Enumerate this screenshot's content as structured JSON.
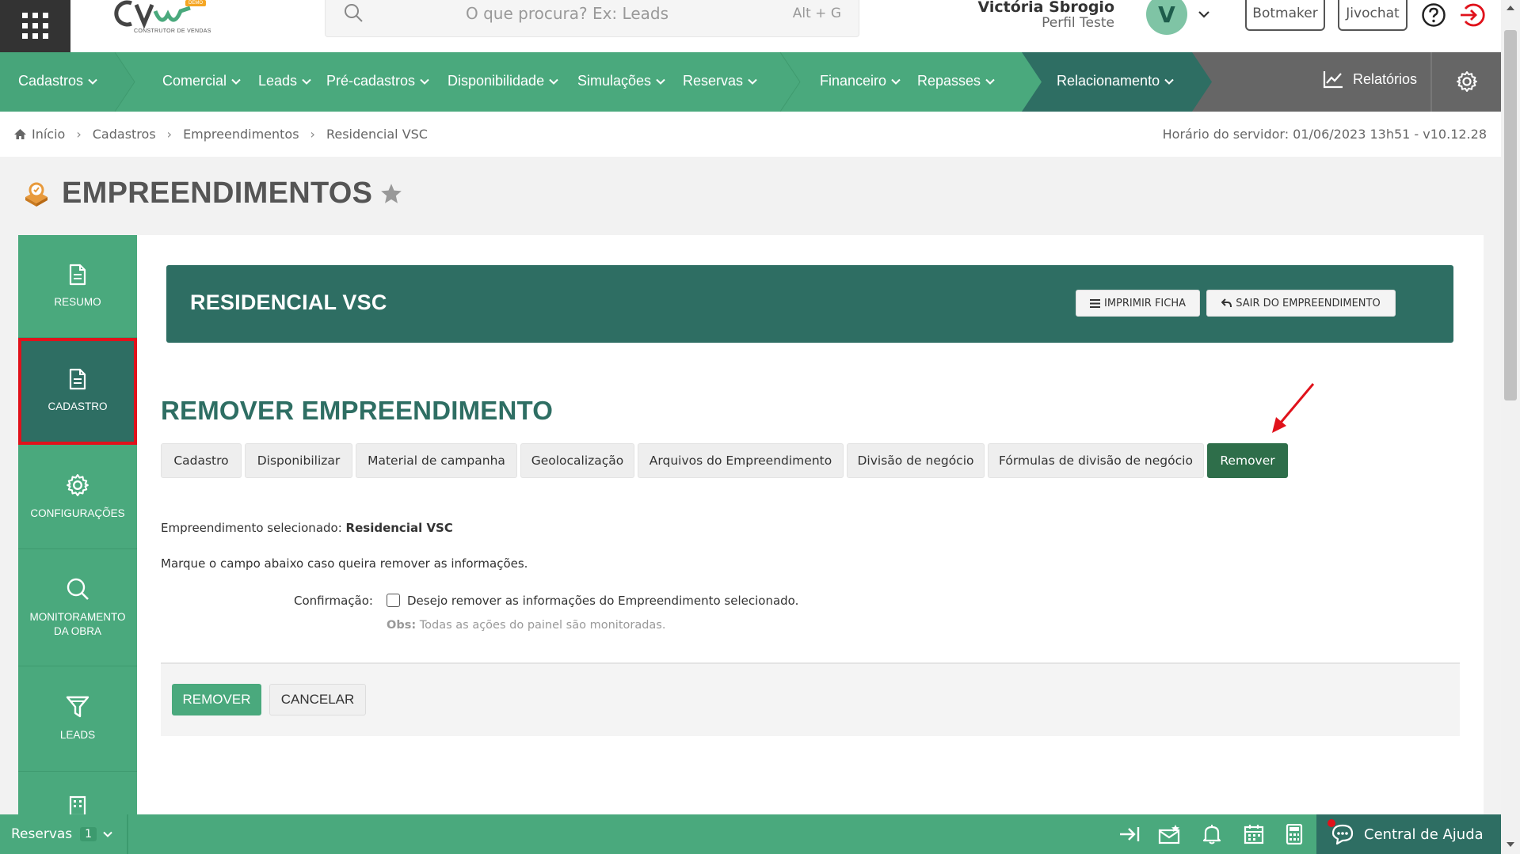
{
  "header": {
    "logo_text": "CONSTRUTOR DE VENDAS",
    "logo_badge": "DEMO",
    "search_placeholder": "O que procura? Ex: Leads",
    "search_shortcut": "Alt + G",
    "user_name": "Victória Sbrogio",
    "user_profile": "Perfil Teste",
    "avatar_initial": "V",
    "btn_botmaker": "Botmaker",
    "btn_jivochat": "Jivochat"
  },
  "nav": {
    "items": [
      {
        "label": "Cadastros"
      },
      {
        "label": "Comercial"
      },
      {
        "label": "Leads"
      },
      {
        "label": "Pré-cadastros"
      },
      {
        "label": "Disponibilidade"
      },
      {
        "label": "Simulações"
      },
      {
        "label": "Reservas"
      },
      {
        "label": "Financeiro"
      },
      {
        "label": "Repasses"
      },
      {
        "label": "Relacionamento"
      }
    ],
    "reports": "Relatórios"
  },
  "breadcrumb": {
    "items": [
      "Início",
      "Cadastros",
      "Empreendimentos",
      "Residencial VSC"
    ],
    "server_time": "Horário do servidor: 01/06/2023 13h51 - v10.12.28"
  },
  "page": {
    "title": "EMPREENDIMENTOS"
  },
  "sidebar": {
    "items": [
      {
        "label": "RESUMO"
      },
      {
        "label": "CADASTRO"
      },
      {
        "label": "CONFIGURAÇÕES"
      },
      {
        "label": "MONITORAMENTO DA OBRA"
      },
      {
        "label": "LEADS"
      }
    ]
  },
  "banner": {
    "title": "RESIDENCIAL VSC",
    "btn_print": "IMPRIMIR FICHA",
    "btn_exit": "SAIR DO EMPREENDIMENTO"
  },
  "section": {
    "title": "REMOVER EMPREENDIMENTO",
    "tabs": [
      {
        "label": "Cadastro"
      },
      {
        "label": "Disponibilizar"
      },
      {
        "label": "Material de campanha"
      },
      {
        "label": "Geolocalização"
      },
      {
        "label": "Arquivos do Empreendimento"
      },
      {
        "label": "Divisão de negócio"
      },
      {
        "label": "Fórmulas de divisão de negócio"
      },
      {
        "label": "Remover"
      }
    ],
    "selected_label": "Empreendimento selecionado:",
    "selected_value": "Residencial VSC",
    "instructions": "Marque o campo abaixo caso queira remover as informações.",
    "confirm_label": "Confirmação:",
    "confirm_text": "Desejo remover as informações do Empreendimento selecionado.",
    "obs_label": "Obs:",
    "obs_text": "Todas as ações do painel são monitoradas.",
    "btn_remove": "REMOVER",
    "btn_cancel": "CANCELAR"
  },
  "bottombar": {
    "reservas_label": "Reservas",
    "reservas_count": "1",
    "help_center": "Central de Ajuda"
  },
  "colors": {
    "nav_green": "#4aa97d",
    "dark_teal": "#2e6e63",
    "active_tab": "#2e6e4a",
    "highlight_red": "#e0121b",
    "reports_gray": "#666666"
  }
}
